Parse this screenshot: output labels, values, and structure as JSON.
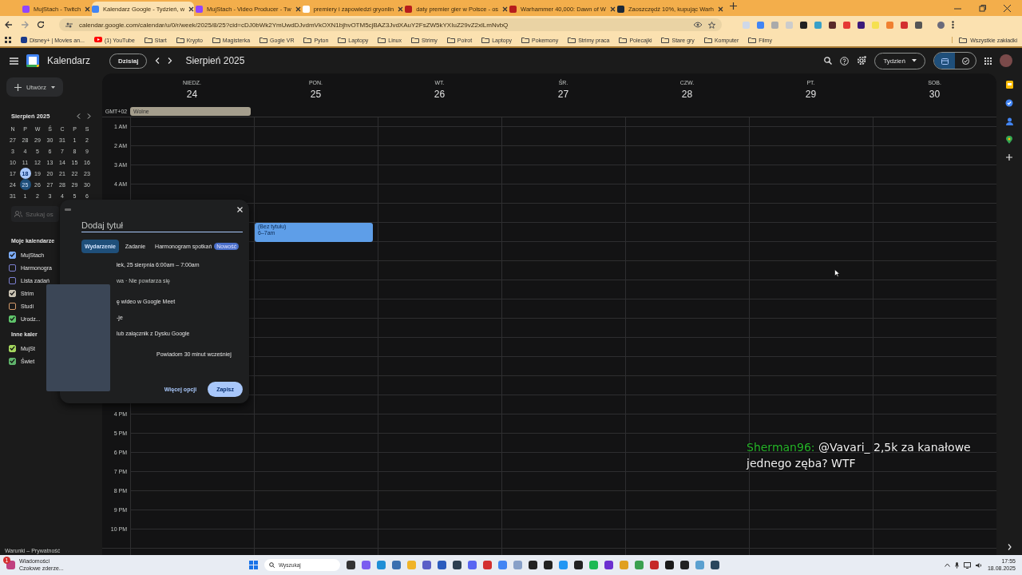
{
  "browser": {
    "tabs": [
      {
        "title": "MujStach - Twitch",
        "selected": false
      },
      {
        "title": "Kalendarz Google - Tydzień, w",
        "selected": true
      },
      {
        "title": "MujStach - Video Producer - Tw",
        "selected": false
      },
      {
        "title": "premiery i zapowiedzi gryonlin",
        "selected": false
      },
      {
        "title": "daty premier gier w Polsce - os",
        "selected": false
      },
      {
        "title": "Warhammer 40,000: Dawn of W",
        "selected": false
      },
      {
        "title": "Zaoszczędź 10%, kupując Warh",
        "selected": false
      }
    ],
    "url": "calendar.google.com/calendar/u/0/r/week/2025/8/25?cid=cDJ0bWk2YmUwdDJvdmVkOXN1bjhvOTM5cjBAZ3JvdXAuY2FsZW5kYXIuZ29vZ2xlLmNvbQ",
    "bookmarks": [
      {
        "label": "Disney+ | Movies an...",
        "kind": "site"
      },
      {
        "label": "(1) YouTube",
        "kind": "video"
      },
      {
        "label": "Start",
        "kind": "folder"
      },
      {
        "label": "Krypto",
        "kind": "folder"
      },
      {
        "label": "Magisterka",
        "kind": "folder"
      },
      {
        "label": "Gogle VR",
        "kind": "folder"
      },
      {
        "label": "Pyton",
        "kind": "folder"
      },
      {
        "label": "Laptopy",
        "kind": "folder"
      },
      {
        "label": "Linux",
        "kind": "folder"
      },
      {
        "label": "Strimy",
        "kind": "folder"
      },
      {
        "label": "Poirot",
        "kind": "folder"
      },
      {
        "label": "Laptopy",
        "kind": "folder"
      },
      {
        "label": "Pokemony",
        "kind": "folder"
      },
      {
        "label": "Strimy praca",
        "kind": "folder"
      },
      {
        "label": "Polecajki",
        "kind": "folder"
      },
      {
        "label": "Stare gry",
        "kind": "folder"
      },
      {
        "label": "Komputer",
        "kind": "folder"
      },
      {
        "label": "Filmy",
        "kind": "folder"
      }
    ],
    "all_bookmarks": "Wszystkie zakładki"
  },
  "calendar": {
    "app_name": "Kalendarz",
    "today_button": "Dzisiaj",
    "period": "Sierpień 2025",
    "view_button": "Tydzień",
    "view_toggle": [
      {
        "kind": "calendar",
        "selected": true
      },
      {
        "kind": "tasks",
        "selected": false
      }
    ],
    "create_button": "Utwórz",
    "mini_calendar": {
      "title": "Sierpień 2025",
      "weekdays": [
        "N",
        "P",
        "W",
        "Ś",
        "C",
        "P",
        "S"
      ],
      "weeks": [
        [
          {
            "day": "27",
            "today": false,
            "selected": false
          },
          {
            "day": "28",
            "today": false,
            "selected": false
          },
          {
            "day": "29",
            "today": false,
            "selected": false
          },
          {
            "day": "30",
            "today": false,
            "selected": false
          },
          {
            "day": "31",
            "today": false,
            "selected": false
          },
          {
            "day": "1",
            "today": false,
            "selected": false
          },
          {
            "day": "2",
            "today": false,
            "selected": false
          }
        ],
        [
          {
            "day": "3",
            "today": false,
            "selected": false
          },
          {
            "day": "4",
            "today": false,
            "selected": false
          },
          {
            "day": "5",
            "today": false,
            "selected": false
          },
          {
            "day": "6",
            "today": false,
            "selected": false
          },
          {
            "day": "7",
            "today": false,
            "selected": false
          },
          {
            "day": "8",
            "today": false,
            "selected": false
          },
          {
            "day": "9",
            "today": false,
            "selected": false
          }
        ],
        [
          {
            "day": "10",
            "today": false,
            "selected": false
          },
          {
            "day": "11",
            "today": false,
            "selected": false
          },
          {
            "day": "12",
            "today": false,
            "selected": false
          },
          {
            "day": "13",
            "today": false,
            "selected": false
          },
          {
            "day": "14",
            "today": false,
            "selected": false
          },
          {
            "day": "15",
            "today": false,
            "selected": false
          },
          {
            "day": "16",
            "today": false,
            "selected": false
          }
        ],
        [
          {
            "day": "17",
            "today": false,
            "selected": false
          },
          {
            "day": "18",
            "today": true,
            "selected": false
          },
          {
            "day": "19",
            "today": false,
            "selected": false
          },
          {
            "day": "20",
            "today": false,
            "selected": false
          },
          {
            "day": "21",
            "today": false,
            "selected": false
          },
          {
            "day": "22",
            "today": false,
            "selected": false
          },
          {
            "day": "23",
            "today": false,
            "selected": false
          }
        ],
        [
          {
            "day": "24",
            "today": false,
            "selected": false
          },
          {
            "day": "25",
            "today": false,
            "selected": true
          },
          {
            "day": "26",
            "today": false,
            "selected": false
          },
          {
            "day": "27",
            "today": false,
            "selected": false
          },
          {
            "day": "28",
            "today": false,
            "selected": false
          },
          {
            "day": "29",
            "today": false,
            "selected": false
          },
          {
            "day": "30",
            "today": false,
            "selected": false
          }
        ],
        [
          {
            "day": "31",
            "today": false,
            "selected": false
          },
          {
            "day": "1",
            "today": false,
            "selected": false
          },
          {
            "day": "2",
            "today": false,
            "selected": false
          },
          {
            "day": "3",
            "today": false,
            "selected": false
          },
          {
            "day": "4",
            "today": false,
            "selected": false
          },
          {
            "day": "5",
            "today": false,
            "selected": false
          },
          {
            "day": "6",
            "today": false,
            "selected": false
          }
        ]
      ]
    },
    "people_search": {
      "placeholder": "Szukaj os"
    },
    "my_calendars": {
      "title": "Moje kalendarze",
      "items": [
        {
          "label": "MujStach",
          "checked": true,
          "color": "#7cacf8"
        },
        {
          "label": "Harmonogra",
          "checked": false,
          "color": "#7b7fd0"
        },
        {
          "label": "Lista zadań",
          "checked": false,
          "color": "#7b7fd0"
        },
        {
          "label": "Strim",
          "checked": true,
          "color": "#c9c2b2"
        },
        {
          "label": "Studi",
          "checked": false,
          "color": "#d49a6a"
        },
        {
          "label": "Urodz...",
          "checked": true,
          "color": "#5fc46b"
        }
      ]
    },
    "other_calendars": {
      "title": "Inne kaler",
      "items": [
        {
          "label": "MujSt",
          "checked": true,
          "color": "#a4d65e"
        },
        {
          "label": "Świet",
          "checked": true,
          "color": "#5fb36b"
        }
      ]
    },
    "footer": "Warunki – Prywatność",
    "timezone": "GMT+02",
    "days": [
      {
        "weekday": "NIEDZ.",
        "date": "24"
      },
      {
        "weekday": "PON.",
        "date": "25"
      },
      {
        "weekday": "WT.",
        "date": "26"
      },
      {
        "weekday": "ŚR.",
        "date": "27"
      },
      {
        "weekday": "CZW.",
        "date": "28"
      },
      {
        "weekday": "PT.",
        "date": "29"
      },
      {
        "weekday": "SOB.",
        "date": "30"
      }
    ],
    "all_day_events": [
      {
        "title": "Wolne"
      }
    ],
    "hour_labels_top": [
      "1 AM",
      "2 AM",
      "3 AM",
      "4 AM"
    ],
    "hour_labels_bottom": [
      "4 PM",
      "5 PM",
      "6 PM",
      "7 PM",
      "8 PM",
      "9 PM",
      "10 PM"
    ],
    "events": [
      {
        "title": "(Bez tytułu)",
        "time": "6–7am"
      }
    ],
    "popup": {
      "title_placeholder": "Dodaj tytuł",
      "tabs": [
        {
          "label": "Wydarzenie",
          "selected": true
        },
        {
          "label": "Zadanie",
          "selected": false
        },
        {
          "label": "Harmonogram spotkań",
          "selected": false,
          "badge": "Nowość"
        }
      ],
      "lines": [
        "łek, 25 sierpnia   6:00am  –  7:00am",
        "wa · Nie powtarza się",
        "ę wideo w Google Meet",
        "-je",
        "lub załącznik z Dysku Google",
        "Powiadom 30 minut wcześniej"
      ],
      "more_button": "Więcej opcji",
      "save_button": "Zapisz"
    }
  },
  "chat_overlay": {
    "user": "Sherman96:",
    "message": "@Vavari_ 2,5k za kanałowe jednego zęba? WTF"
  },
  "taskbar": {
    "news_badge": "1",
    "news_title": "Wiadomości",
    "news_text": "Czołowe zderze...",
    "search_placeholder": "Wyszukaj",
    "time": "17:55",
    "date": "18.08.2025"
  }
}
